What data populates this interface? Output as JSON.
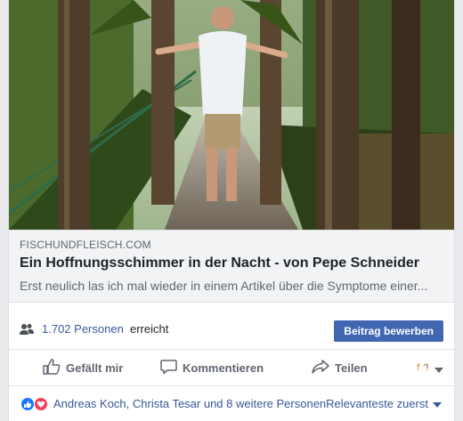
{
  "post": {
    "image_alt": "Person with outstretched arms on a palm-lined garden path",
    "link": {
      "domain": "FISCHUNDFLEISCH.COM",
      "title": "Ein Hoffnungsschimmer in der Nacht - von Pepe Schneider",
      "description": "Erst neulich las ich mal wieder in einem Artikel über die Symptome einer..."
    },
    "reach": {
      "count_text": "1.702 Personen",
      "suffix_text": "erreicht",
      "promote_label": "Beitrag bewerben"
    },
    "actions": {
      "like_label": "Gefällt mir",
      "comment_label": "Kommentieren",
      "share_label": "Teilen"
    },
    "likes": {
      "text": "Andreas Koch, Christa Tesar und 8 weitere Personen",
      "sort_label": "Relevanteste zuerst"
    }
  },
  "colors": {
    "brand_blue": "#4267b2",
    "link_blue": "#385898",
    "like_blue": "#1877f2",
    "love_red": "#f33e58",
    "muted_text": "#606770"
  },
  "icons": [
    "people-icon",
    "thumbs-up-icon",
    "comment-icon",
    "share-icon",
    "avatar-reaction-icon",
    "chevron-down-icon",
    "like-reaction-icon",
    "love-reaction-icon"
  ]
}
